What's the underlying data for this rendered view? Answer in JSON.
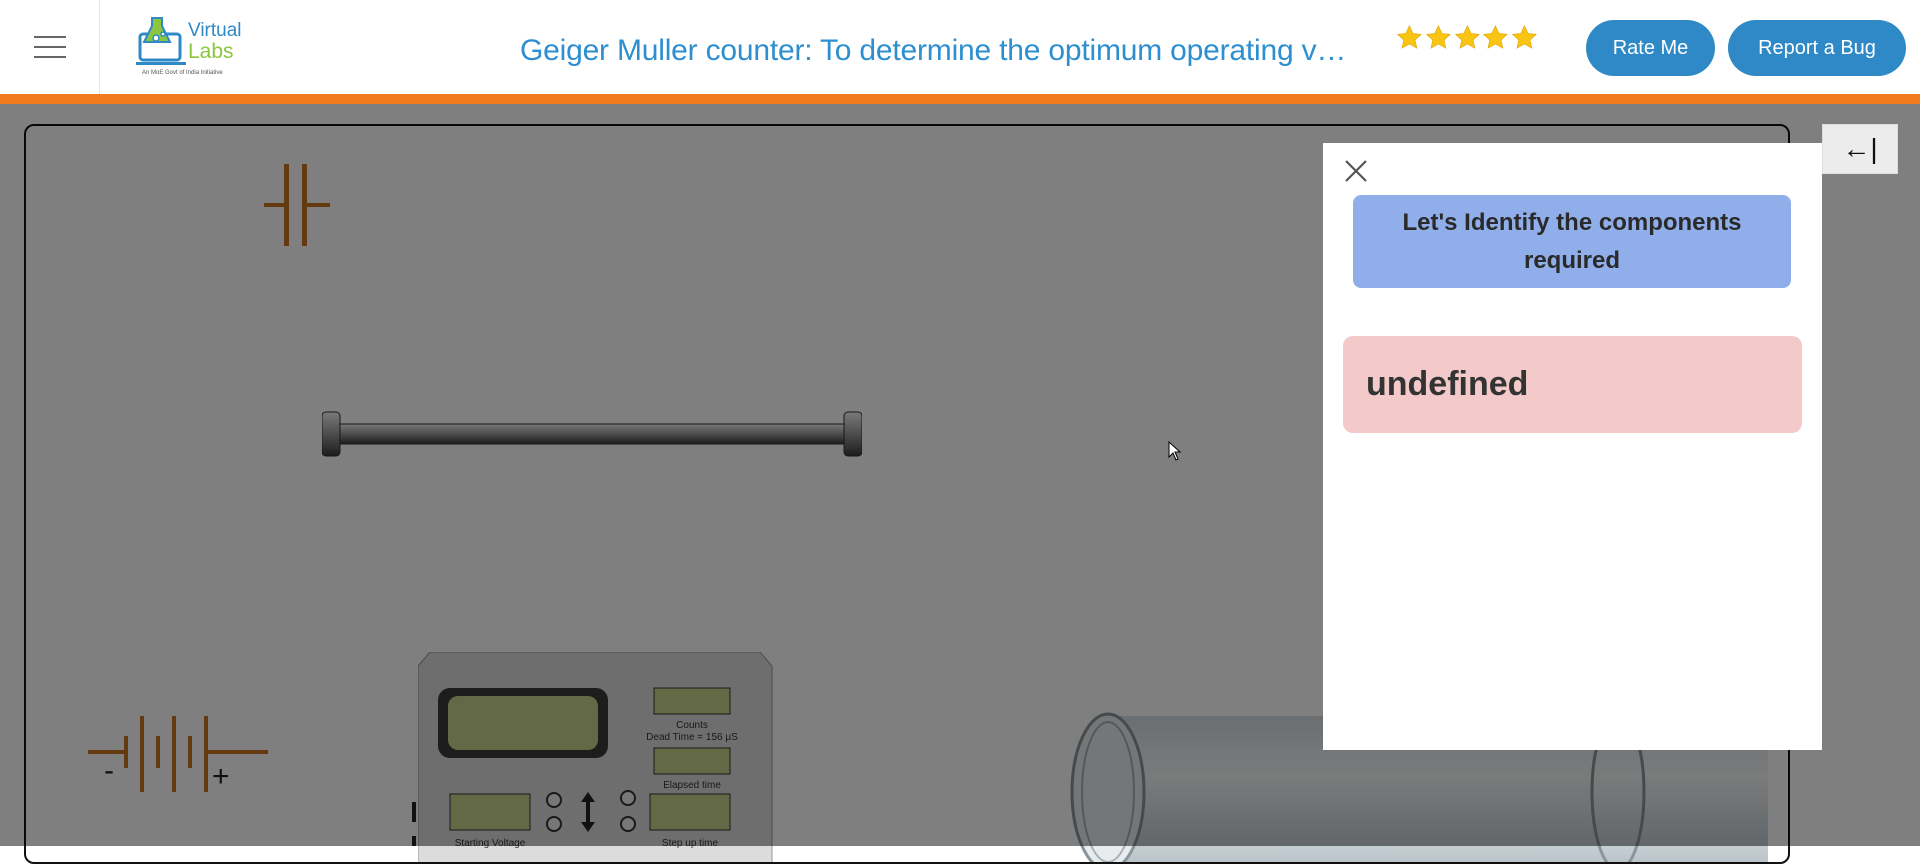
{
  "header": {
    "title": "Geiger Muller counter: To determine the optimum operating voltage of the GM counter",
    "logo_text_1": "Virtual",
    "logo_text_2": "Labs",
    "logo_tagline": "An MoE Govt of India Initiative",
    "rating_stars": 5,
    "rate_button": "Rate Me",
    "bug_button": "Report a Bug"
  },
  "sidebar_toggle": {
    "label": "←|"
  },
  "dialog": {
    "heading": "Let's Identify the components required",
    "message": "undefined"
  },
  "equipment": {
    "battery_minus": "-",
    "battery_plus": "+",
    "counter_labels": {
      "counts": "Counts",
      "dead_time": "Dead Time = 156 μS",
      "elapsed": "Elapsed time",
      "starting_voltage": "Starting Voltage",
      "step_up": "Step up time"
    }
  },
  "colors": {
    "accent": "#2e89c6",
    "header_bar": "#f07a1c",
    "title": "#2d8fcf",
    "component": "#c8761e",
    "dialog_heading_bg": "#90aeea",
    "dialog_message_bg": "#f3c9c9"
  }
}
